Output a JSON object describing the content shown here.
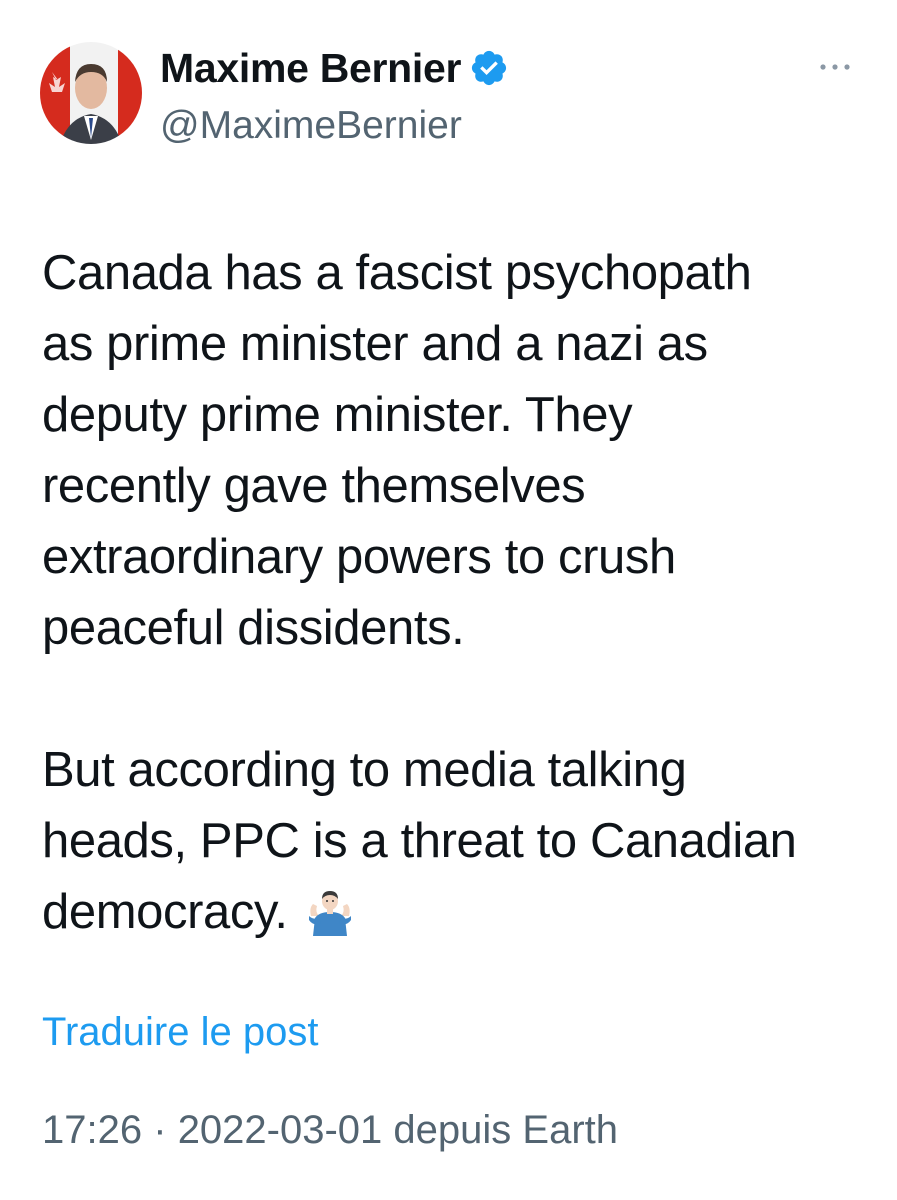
{
  "author": {
    "display_name": "Maxime Bernier",
    "handle": "@MaximeBernier",
    "verified_icon": "verified-badge-icon",
    "avatar_icon": "profile-avatar"
  },
  "menu": {
    "more_icon": "more-options-icon",
    "more_glyph": "···"
  },
  "tweet": {
    "paragraph_1_lines": [
      "Canada has a fascist psychopath",
      "as prime minister and a nazi as",
      "deputy prime minister. They",
      "recently gave themselves",
      "extraordinary powers to crush",
      "peaceful dissidents."
    ],
    "paragraph_2_lines": [
      "But according to media talking",
      "heads, PPC is a threat to Canadian",
      "democracy."
    ],
    "emoji_icon": "man-shrugging-emoji-icon"
  },
  "translate_label": "Traduire le post",
  "meta": {
    "time": "17:26",
    "separator": "·",
    "date": "2022-03-01",
    "source": "depuis Earth"
  },
  "colors": {
    "text": "#0f1419",
    "secondary": "#536471",
    "link": "#1d9bf0",
    "verified": "#1d9bf0"
  }
}
